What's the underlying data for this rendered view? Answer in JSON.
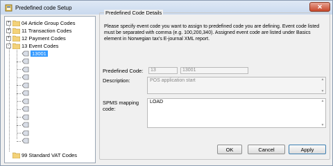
{
  "window": {
    "title": "Predefined code Setup"
  },
  "tree": {
    "items": [
      {
        "label": "04 Article Group Codes",
        "expander": "+"
      },
      {
        "label": "11 Transaction Codes",
        "expander": "+"
      },
      {
        "label": "12 Payment Codes",
        "expander": "+"
      },
      {
        "label": "13 Event Codes",
        "expander": "-"
      },
      {
        "label": "99 Standard VAT Codes",
        "expander": ""
      }
    ],
    "selected_child": "13001",
    "child_count": 12
  },
  "details": {
    "group_title": "Predefined Code Details",
    "description": "Please specify event code you want to assign to predefined code you are defining. Event code listed must be separated with comma (e.g. 100,200,340). Assigned event code are listed under Basics element in Norwegian tax's E-journal XML report.",
    "predefined_code_label": "Predefined Code:",
    "predefined_code_group": "13",
    "predefined_code_value": "13001",
    "description_label": "Description:",
    "description_value": "POS application start",
    "spms_label_line1": "SPMS mapping",
    "spms_label_line2": "code:",
    "spms_value": "LOAD"
  },
  "buttons": {
    "ok": "OK",
    "cancel": "Cancel",
    "apply": "Apply"
  }
}
